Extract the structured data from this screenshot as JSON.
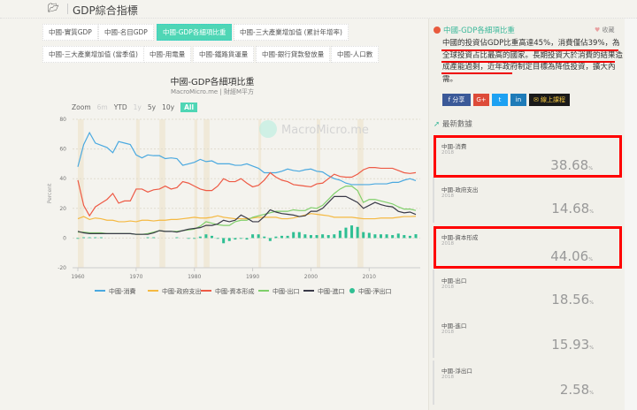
{
  "header": {
    "title": "GDP綜合指標",
    "icon": "folder-open-icon"
  },
  "tabs": [
    "中國-實質GDP",
    "中國-名目GDP",
    "中國-GDP各細項比重",
    "中國-三大產業增加值 (累計年增率)",
    "中國-三大產業增加值 (當季值)",
    "中國-用電量",
    "中國-鐵路貨運量",
    "中國-銀行貸款發放量",
    "中國-人口數"
  ],
  "active_tab": 2,
  "chart": {
    "title": "中國-GDP各細項比重",
    "subtitle": "MacroMicro.me | 財經M平方",
    "watermark": "MacroMicro.me",
    "zoom": {
      "label": "Zoom",
      "options": [
        "6m",
        "YTD",
        "1y",
        "5y",
        "10y",
        "All"
      ],
      "active": "All"
    }
  },
  "chart_data": {
    "type": "line",
    "title": "中國-GDP各細項比重",
    "ylabel": "Percent",
    "ylim": [
      -20,
      80
    ],
    "yticks": [
      80,
      60,
      40,
      20,
      0,
      -20
    ],
    "xlim": [
      1960,
      2018
    ],
    "xticks": [
      1960,
      1970,
      1980,
      1990,
      2000,
      2010
    ],
    "start_year": 1960,
    "recessions": [
      [
        1960,
        1961
      ],
      [
        1970,
        1970.6
      ],
      [
        1974,
        1975
      ],
      [
        1980,
        1980.5
      ],
      [
        1981.6,
        1982.6
      ],
      [
        1991,
        1991.4
      ],
      [
        2001,
        2001.6
      ],
      [
        2008,
        2009
      ]
    ],
    "series": [
      {
        "name": "中國-消費",
        "color": "#4aa9e0",
        "type": "line",
        "values": [
          48,
          63,
          71,
          64,
          62.5,
          61,
          57.5,
          65,
          64,
          63,
          56,
          54,
          56,
          55.5,
          55.5,
          53.5,
          54,
          53.5,
          49,
          50,
          51,
          53,
          51.5,
          52,
          50,
          50,
          50,
          49,
          49,
          50,
          48.5,
          47,
          44,
          44,
          44,
          45,
          46.5,
          45.5,
          45,
          46,
          46.5,
          45,
          44.5,
          42,
          40,
          39,
          37,
          36,
          36,
          36,
          36,
          36.5,
          36.5,
          36.5,
          37.5,
          37.5,
          39,
          40,
          38.68
        ]
      },
      {
        "name": "中國-政府支出",
        "color": "#f5b942",
        "type": "line",
        "values": [
          13,
          14.5,
          12.5,
          13.5,
          13,
          12,
          12,
          11,
          11,
          11.5,
          11,
          12,
          12,
          11.5,
          12,
          12,
          12.5,
          12.5,
          13,
          13.5,
          14,
          13.5,
          13.5,
          14,
          15,
          14,
          13.5,
          13,
          13,
          13,
          13.5,
          14,
          14,
          14,
          14,
          13,
          13,
          13.5,
          14.5,
          15.5,
          16.5,
          16,
          15.5,
          15,
          14,
          14,
          14,
          14,
          13.5,
          13,
          13,
          13,
          13.5,
          13.5,
          13.5,
          14,
          14.5,
          14.5,
          14.68
        ]
      },
      {
        "name": "中國-資本形成",
        "color": "#ee5a45",
        "type": "line",
        "values": [
          39,
          22,
          15,
          21,
          23.5,
          26,
          30,
          23.5,
          25,
          25,
          33,
          33,
          31,
          32.5,
          33,
          35,
          33,
          34,
          38,
          37,
          35,
          33,
          32,
          32,
          35,
          40,
          38,
          38,
          40,
          37,
          34.5,
          35.5,
          39,
          44,
          41,
          39,
          38,
          36,
          35.5,
          35,
          34.5,
          36.5,
          37,
          40,
          43,
          41.5,
          41,
          41,
          43,
          46,
          47.5,
          47.5,
          47,
          47,
          47,
          45.5,
          44,
          43.5,
          44.06
        ]
      },
      {
        "name": "中國-出口",
        "color": "#7fcf6a",
        "type": "line",
        "values": [
          4,
          4,
          3.5,
          3.5,
          3.5,
          3,
          3,
          3,
          3,
          3,
          2.5,
          2.5,
          3,
          4,
          5,
          4.5,
          4.5,
          4.5,
          5,
          5.5,
          6,
          8,
          11,
          10,
          9,
          8.5,
          8.5,
          11,
          12,
          12,
          14,
          15,
          16,
          17,
          18,
          18,
          18,
          19,
          18.5,
          18.5,
          20.5,
          20,
          22,
          26,
          30,
          33,
          35,
          35,
          32,
          24,
          26,
          26,
          25,
          24,
          23,
          21,
          19.5,
          19.5,
          18.56
        ]
      },
      {
        "name": "中國-進口",
        "color": "#3a3a48",
        "type": "line",
        "values": [
          4.5,
          3.5,
          3,
          3,
          3,
          3,
          3,
          3,
          3,
          3,
          2.5,
          2.5,
          2.5,
          3.5,
          5,
          4.5,
          4.5,
          4,
          5,
          6,
          6.5,
          7,
          8.5,
          8.5,
          9.5,
          12,
          11,
          12,
          15.5,
          13.5,
          11,
          11,
          14.5,
          19,
          17.5,
          16.5,
          16,
          15.5,
          14.5,
          15,
          18,
          18,
          20,
          24,
          28,
          28,
          28,
          26,
          24,
          20,
          22,
          24,
          22.5,
          21.5,
          21,
          18,
          17,
          17.5,
          15.93
        ]
      },
      {
        "name": "中國-淨出口",
        "color": "#2fbf93",
        "type": "bar",
        "values": [
          -0.5,
          0.5,
          0.5,
          0.5,
          0.5,
          0,
          0,
          0,
          0,
          0,
          0,
          0,
          0.5,
          0.5,
          0,
          0,
          0,
          0.5,
          0,
          -0.5,
          -0.5,
          1,
          2.5,
          1.5,
          -0.5,
          -3.5,
          -2,
          -1,
          -0.5,
          -1,
          2.5,
          2.5,
          1,
          -2,
          1,
          1.5,
          1.5,
          4,
          4,
          2.5,
          2,
          2,
          2.5,
          2,
          2.5,
          5,
          7,
          8.5,
          7.5,
          4,
          3.5,
          2.5,
          2.5,
          2.5,
          2,
          3,
          2,
          1.5,
          2.58
        ]
      }
    ]
  },
  "panel": {
    "title": "中國-GDP各細項比重",
    "favorite": "收藏",
    "description": "中國的投資佔GDP比重高達45%，消費僅佔39%，為全球投資占比最高的國家。長期投資大於消費的結果造成產能過剩，近年政府制定目標為降低投資，擴大內需。",
    "share": [
      "分享",
      "G+",
      "t",
      "in",
      "線上課程"
    ],
    "latest_label": "最新數據",
    "latest": [
      {
        "label": "中國-消費",
        "year": "2018",
        "value": "38.68",
        "unit": "%",
        "highlight": true
      },
      {
        "label": "中國-政府支出",
        "year": "2018",
        "value": "14.68",
        "unit": "%",
        "highlight": false
      },
      {
        "label": "中國-資本形成",
        "year": "2018",
        "value": "44.06",
        "unit": "%",
        "highlight": true
      },
      {
        "label": "中國-出口",
        "year": "2018",
        "value": "18.56",
        "unit": "%",
        "highlight": false
      },
      {
        "label": "中國-進口",
        "year": "2018",
        "value": "15.93",
        "unit": "%",
        "highlight": false
      },
      {
        "label": "中國-淨出口",
        "year": "2018",
        "value": "2.58",
        "unit": "%",
        "highlight": false
      }
    ]
  }
}
